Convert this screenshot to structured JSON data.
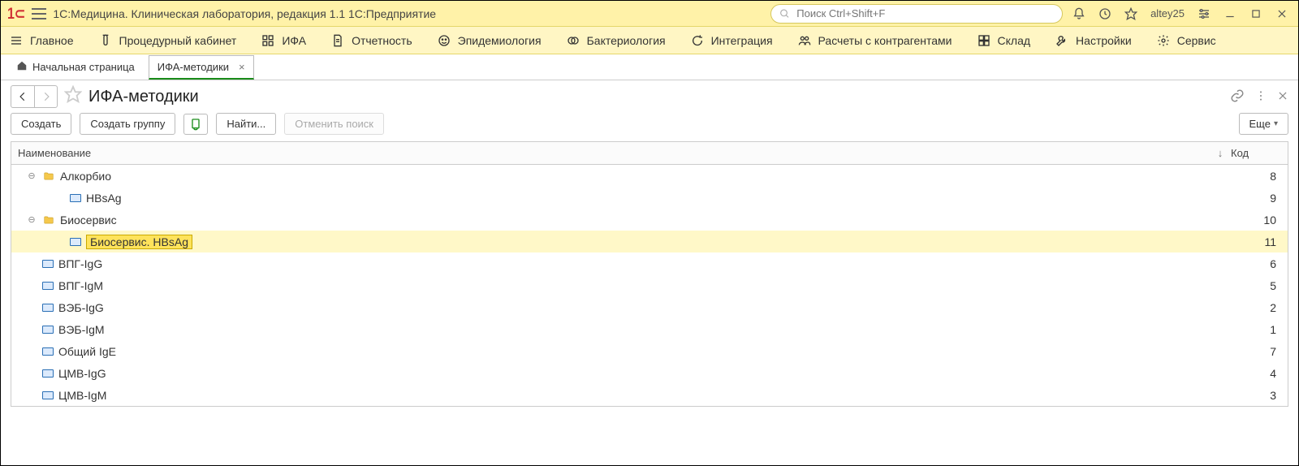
{
  "app": {
    "title": "1С:Медицина. Клиническая лаборатория, редакция 1.1 1С:Предприятие",
    "search_placeholder": "Поиск Ctrl+Shift+F",
    "user": "altey25"
  },
  "mainnav": [
    {
      "icon": "menu",
      "label": "Главное"
    },
    {
      "icon": "tube",
      "label": "Процедурный кабинет"
    },
    {
      "icon": "grid",
      "label": "ИФА"
    },
    {
      "icon": "doc",
      "label": "Отчетность"
    },
    {
      "icon": "face",
      "label": "Эпидемиология"
    },
    {
      "icon": "rings",
      "label": "Бактериология"
    },
    {
      "icon": "cycle",
      "label": "Интеграция"
    },
    {
      "icon": "people",
      "label": "Расчеты с контрагентами"
    },
    {
      "icon": "boxes",
      "label": "Склад"
    },
    {
      "icon": "wrench",
      "label": "Настройки"
    },
    {
      "icon": "gear",
      "label": "Сервис"
    }
  ],
  "tabs": {
    "home": "Начальная страница",
    "active": "ИФА-методики"
  },
  "page": {
    "title": "ИФА-методики"
  },
  "toolbar": {
    "create": "Создать",
    "create_group": "Создать группу",
    "find": "Найти...",
    "cancel_search": "Отменить поиск",
    "more": "Еще"
  },
  "columns": {
    "name": "Наименование",
    "code": "Код"
  },
  "tree": [
    {
      "type": "folder",
      "level": 0,
      "name": "Алкорбио",
      "code": "8",
      "expanded": true
    },
    {
      "type": "item",
      "level": 1,
      "name": "HBsAg",
      "code": "9"
    },
    {
      "type": "folder",
      "level": 0,
      "name": "Биосервис",
      "code": "10",
      "expanded": true
    },
    {
      "type": "item",
      "level": 1,
      "name": "Биосервис. HBsAg",
      "code": "11",
      "selected": true
    },
    {
      "type": "item",
      "level": 0,
      "name": "ВПГ-IgG",
      "code": "6"
    },
    {
      "type": "item",
      "level": 0,
      "name": "ВПГ-IgM",
      "code": "5"
    },
    {
      "type": "item",
      "level": 0,
      "name": "ВЭБ-IgG",
      "code": "2"
    },
    {
      "type": "item",
      "level": 0,
      "name": "ВЭБ-IgM",
      "code": "1"
    },
    {
      "type": "item",
      "level": 0,
      "name": "Общий IgE",
      "code": "7"
    },
    {
      "type": "item",
      "level": 0,
      "name": "ЦМВ-IgG",
      "code": "4"
    },
    {
      "type": "item",
      "level": 0,
      "name": "ЦМВ-IgM",
      "code": "3"
    }
  ]
}
